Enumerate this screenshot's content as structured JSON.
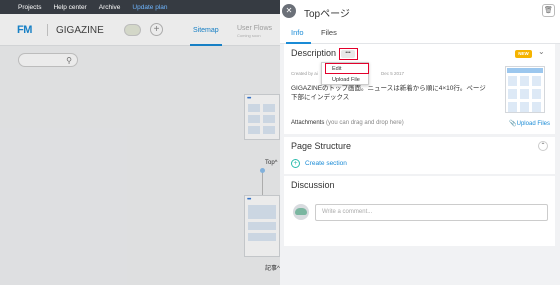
{
  "topnav": {
    "items": [
      "Projects",
      "Help center",
      "Archive"
    ],
    "upgrade": "Update plan"
  },
  "project": {
    "logo": "FM",
    "name": "GIGAZINE",
    "plus": "+",
    "tab_sitemap": "Sitemap",
    "tab_userflows": "User Flows",
    "tab_userflows_sub": "Coming soon"
  },
  "sitemap": {
    "card1_caption": "Top^",
    "card2_caption": "記事^"
  },
  "panel": {
    "title": "Topページ",
    "tabs": {
      "info": "Info",
      "files": "Files"
    },
    "description": {
      "title": "Description",
      "more": "•••",
      "badge": "NEW",
      "meta_left": "Created by ai",
      "meta_right": "Dec 5 2017",
      "text": "GIGAZINEのトップ画面。ニュースは新着から順に4×10行。ページ下部にインデックス",
      "attachments_label": "Attachments",
      "attachments_hint": "(you can drag and drop here)",
      "upload_link": "Upload Files"
    },
    "menu": {
      "edit": "Edit",
      "upload": "Upload File"
    },
    "page_structure": {
      "title": "Page Structure",
      "create": "Create section"
    },
    "discussion": {
      "title": "Discussion",
      "placeholder": "Write a comment..."
    }
  },
  "colors": {
    "accent": "#1a8bd6",
    "highlight": "#e3002b",
    "badge": "#f5b400",
    "topnav": "#363b42"
  }
}
